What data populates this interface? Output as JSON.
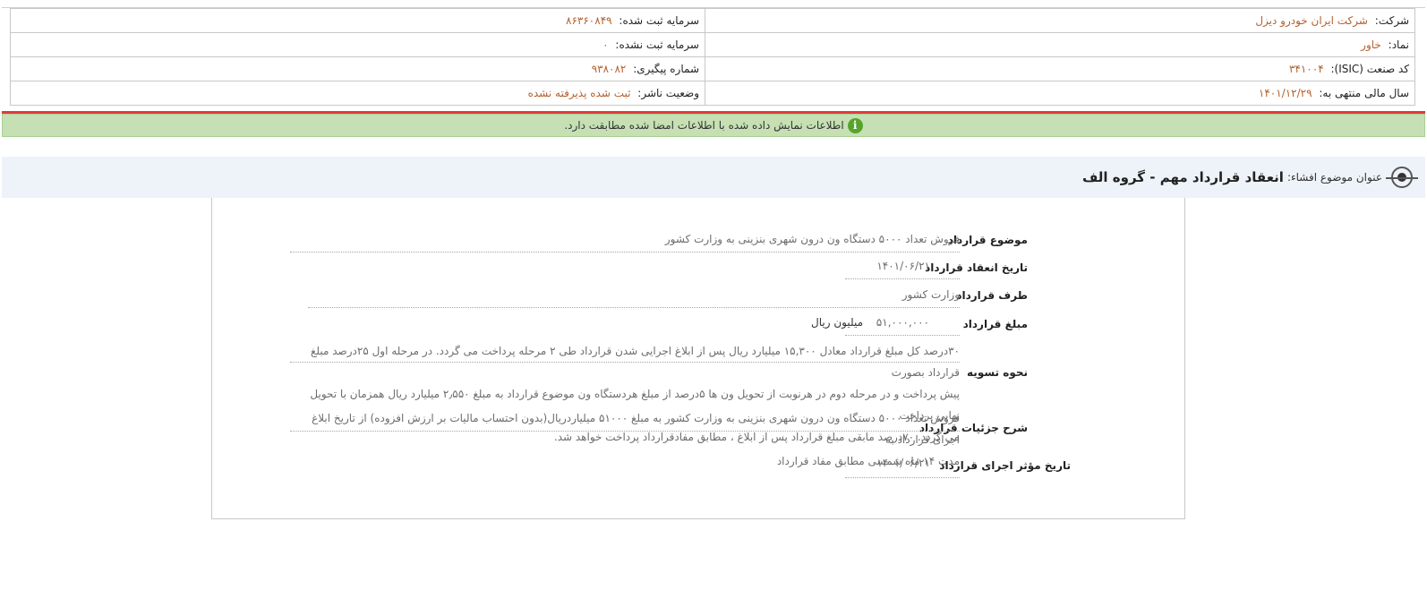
{
  "company_info": {
    "company_label": "شرکت:",
    "company_value": "شرکت ایران خودرو دیزل",
    "registered_capital_label": "سرمایه ثبت شده:",
    "registered_capital_value": "۸۶۳۶۰۸۴۹",
    "symbol_label": "نماد:",
    "symbol_value": "خاور",
    "unregistered_capital_label": "سرمایه ثبت نشده:",
    "unregistered_capital_value": "۰",
    "isic_label": "کد صنعت (ISIC):",
    "isic_value": "۳۴۱۰۰۴",
    "tracking_label": "شماره پیگیری:",
    "tracking_value": "۹۳۸۰۸۲",
    "fiscal_year_label": "سال مالی منتهی به:",
    "fiscal_year_value": "۱۴۰۱/۱۲/۲۹",
    "publisher_status_label": "وضعیت ناشر:",
    "publisher_status_value": "ثبت شده پذیرفته نشده"
  },
  "notice": {
    "icon": "info-icon",
    "text": "اطلاعات نمایش داده شده با اطلاعات امضا شده مطابقت دارد."
  },
  "disclosure": {
    "title_label": "عنوان موضوع افشاء:",
    "title_text": "انعقاد قرارداد مهم - گروه الف"
  },
  "contract": {
    "subject_label": "موضوع قرارداد",
    "subject_value": "فروش تعداد ۵۰۰۰ دستگاه ون درون شهری بنزینی به وزارت کشور",
    "date_label": "تاریخ انعقاد قرارداد",
    "date_value": "۱۴۰۱/۰۶/۲۱",
    "party_label": "طرف قرارداد",
    "party_value": "وزارت کشور",
    "amount_label": "مبلغ قرارداد",
    "amount_value": "۵۱,۰۰۰,۰۰۰",
    "amount_unit": "میلیون ریال",
    "settlement_label": "نحوه تسویه",
    "settlement_line1": "۳۰درصد کل مبلغ قرارداد معادل ۱۵,۳۰۰ میلیارد ریال پس از ابلاغ اجرایی شدن قرارداد طی ۲ مرحله پرداخت می گردد. در مرحله اول ۲۵درصد مبلغ قرارداد بصورت",
    "settlement_line2": "پیش پرداخت و در مرحله دوم در هرنوبت از تحویل ون ها ۵درصد از مبلغ هردستگاه ون موضوع قرارداد به مبلغ ۲٫۵۵۰ میلیارد ریال همزمان با تحویل نهایی پرداخت",
    "settlement_line3": "می گردد. ۷۰درصد مابقی مبلغ قرارداد پس از ابلاغ ، مطابق مفادقرارداد پرداخت خواهد شد.",
    "details_label": "شرح جزئیات قرارداد",
    "details_line1": "فروش تعداد ۵۰۰۰ دستگاه ون درون شهری بنزینی به وزارت کشور به مبلغ ۵۱۰۰۰ میلیاردریال(بدون احتساب مالیات بر ارزش افزوده) از تاریخ ابلاغ اجرای قرارداد به",
    "details_line2": "مدت ۱۴ ماه شمسی مطابق مفاد قرارداد",
    "effective_date_label": "تاریخ مؤثر اجرای قرارداد",
    "effective_date_value": "۱۴۰۱/۰۶/۲۱"
  },
  "colors": {
    "value_orange": "#b5602e",
    "notice_green": "#c6e0b4",
    "alert_red": "#e23b3b",
    "title_bg": "#eef3f9"
  }
}
